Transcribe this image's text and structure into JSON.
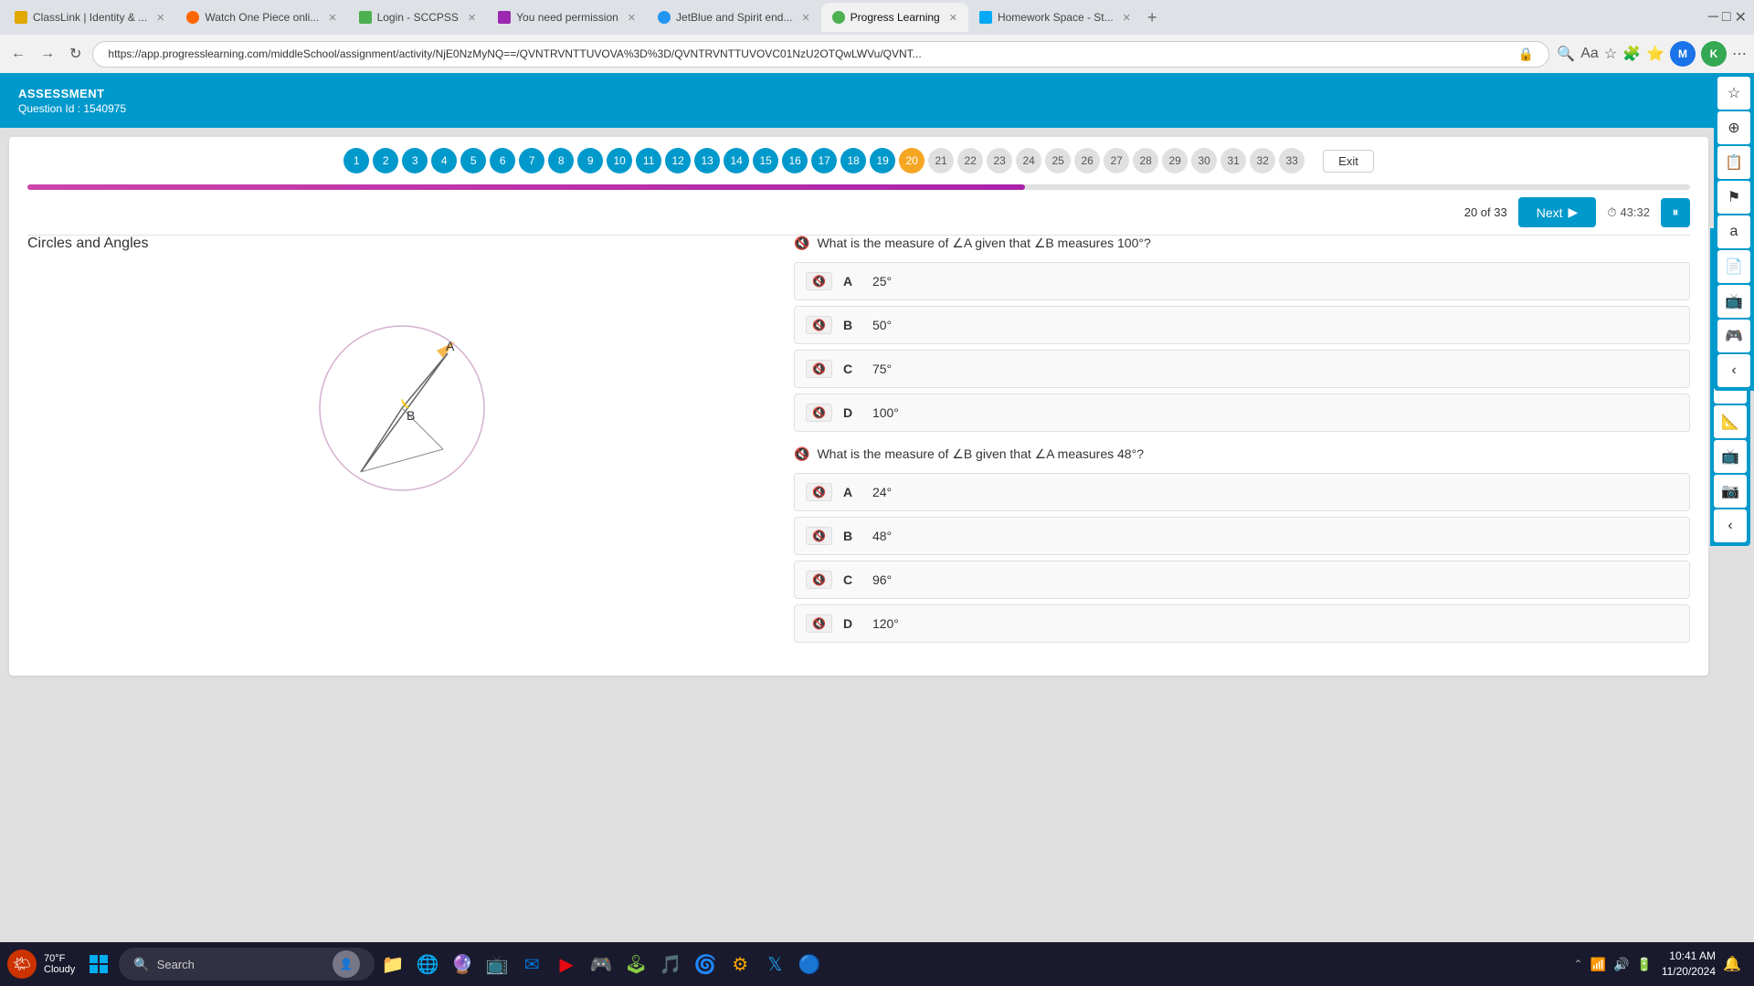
{
  "browser": {
    "tabs": [
      {
        "id": "tab1",
        "label": "ClassLink | Identity &...",
        "active": false,
        "color": "#e0a800"
      },
      {
        "id": "tab2",
        "label": "Watch One Piece onli...",
        "active": false,
        "color": "#ff6600"
      },
      {
        "id": "tab3",
        "label": "Login - SCCPSS",
        "active": false,
        "color": "#4caf50"
      },
      {
        "id": "tab4",
        "label": "You need permission",
        "active": false,
        "color": "#9c27b0"
      },
      {
        "id": "tab5",
        "label": "JetBlue and Spirit end...",
        "active": false,
        "color": "#2196f3"
      },
      {
        "id": "tab6",
        "label": "Progress Learning",
        "active": true,
        "color": "#4caf50"
      },
      {
        "id": "tab7",
        "label": "Homework Space - St...",
        "active": false,
        "color": "#03a9f4"
      }
    ],
    "url": "https://app.progresslearning.com/middleSchool/assignment/activity/NjE0NzMyNQ==/QVNTRVNTTUVOVA%3D%3D/QVNTRVNTTUVOVC01NzU2OTQwLWVu/QVNT..."
  },
  "app": {
    "header": {
      "title": "ASSESSMENT",
      "subtitle": "Question Id : 1540975"
    }
  },
  "question_nav": {
    "total": 33,
    "current": 20,
    "answered_up_to": 19,
    "bubbles": [
      1,
      2,
      3,
      4,
      5,
      6,
      7,
      8,
      9,
      10,
      11,
      12,
      13,
      14,
      15,
      16,
      17,
      18,
      19,
      20,
      21,
      22,
      23,
      24,
      25,
      26,
      27,
      28,
      29,
      30,
      31,
      32,
      33
    ],
    "exit_label": "Exit"
  },
  "nav_row": {
    "count_label": "20 of 33",
    "next_label": "Next",
    "timer": "43:32",
    "timer_icon": "⏱"
  },
  "content": {
    "section_title": "Circles and Angles",
    "question1": {
      "text": "What is the measure of ∠A given that ∠B measures 100°?",
      "options": [
        {
          "letter": "A",
          "text": "25°"
        },
        {
          "letter": "B",
          "text": "50°"
        },
        {
          "letter": "C",
          "text": "75°"
        },
        {
          "letter": "D",
          "text": "100°"
        }
      ]
    },
    "question2": {
      "text": "What is the measure of ∠B given that ∠A measures 48°?",
      "options": [
        {
          "letter": "A",
          "text": "24°"
        },
        {
          "letter": "B",
          "text": "48°"
        },
        {
          "letter": "C",
          "text": "96°"
        },
        {
          "letter": "D",
          "text": "120°"
        }
      ]
    }
  },
  "taskbar": {
    "search_placeholder": "Search",
    "time": "10:41 AM",
    "date": "11/20/2024",
    "weather": "70°F",
    "weather_desc": "Cloudy"
  },
  "progress_percent": 60
}
